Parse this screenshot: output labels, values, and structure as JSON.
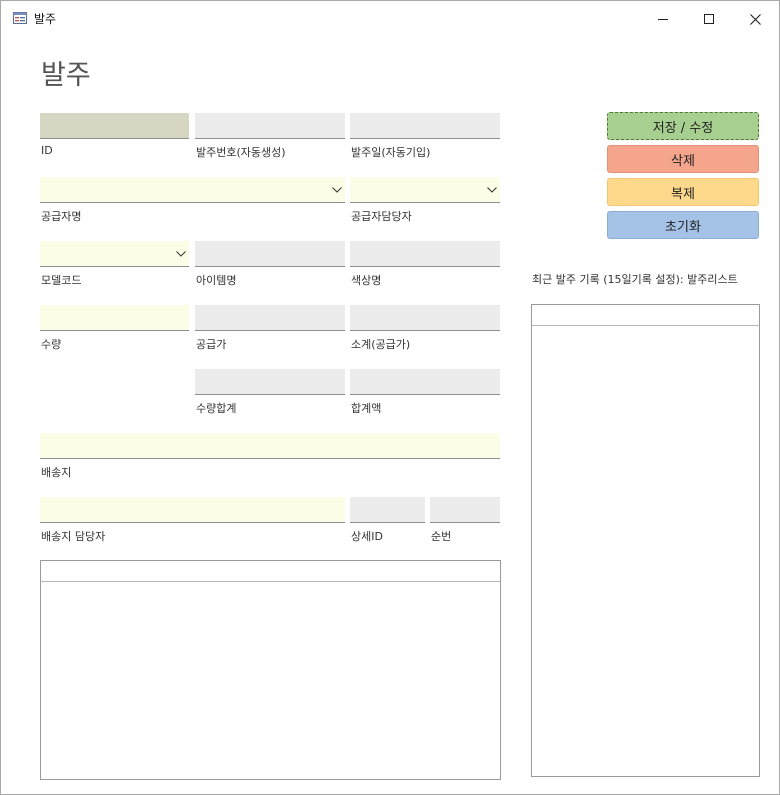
{
  "window": {
    "title": "발주"
  },
  "form": {
    "heading": "발주"
  },
  "fields": {
    "id": {
      "label": "ID",
      "value": ""
    },
    "order_no": {
      "label": "발주번호(자동생성)",
      "value": ""
    },
    "order_date": {
      "label": "발주일(자동기입)",
      "value": ""
    },
    "supplier_name": {
      "label": "공급자명",
      "value": ""
    },
    "supplier_contact": {
      "label": "공급자담당자",
      "value": ""
    },
    "model_code": {
      "label": "모델코드",
      "value": ""
    },
    "item_name": {
      "label": "아이템명",
      "value": ""
    },
    "color_name": {
      "label": "색상명",
      "value": ""
    },
    "quantity": {
      "label": "수량",
      "value": ""
    },
    "supply_price": {
      "label": "공급가",
      "value": ""
    },
    "subtotal": {
      "label": "소계(공급가)",
      "value": ""
    },
    "qty_total": {
      "label": "수량합계",
      "value": ""
    },
    "total_amount": {
      "label": "합계액",
      "value": ""
    },
    "ship_to": {
      "label": "배송지",
      "value": ""
    },
    "ship_contact": {
      "label": "배송지 담당자",
      "value": ""
    },
    "detail_id": {
      "label": "상세ID",
      "value": ""
    },
    "seq_no": {
      "label": "순번",
      "value": ""
    }
  },
  "buttons": {
    "save": "저장 / 수정",
    "delete": "삭제",
    "duplicate": "복제",
    "reset": "초기화"
  },
  "recent": {
    "label": "최근 발주 기록 (15일기록 설정): 발주리스트"
  },
  "colors": {
    "save": "#a7cf8f",
    "delete": "#f4a58c",
    "duplicate": "#fed98c",
    "reset": "#a5c3e6",
    "input_grey": "#ececec",
    "input_yellow": "#fcfde7",
    "input_key": "#d7d6c2"
  }
}
